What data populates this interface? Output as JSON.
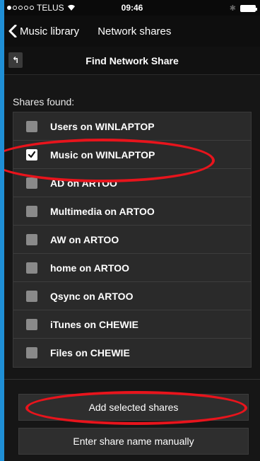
{
  "status_bar": {
    "carrier": "TELUS",
    "time": "09:46",
    "signal_dots_filled": 1,
    "signal_dots_total": 5
  },
  "nav": {
    "back_label": "Music library",
    "tab_label": "Network shares"
  },
  "header": {
    "title": "Find Network Share"
  },
  "shares_label": "Shares found:",
  "shares": [
    {
      "label": "Users on WINLAPTOP",
      "checked": false
    },
    {
      "label": "Music on WINLAPTOP",
      "checked": true
    },
    {
      "label": "AD on ARTOO",
      "checked": false
    },
    {
      "label": "Multimedia on ARTOO",
      "checked": false
    },
    {
      "label": "AW on ARTOO",
      "checked": false
    },
    {
      "label": "home on ARTOO",
      "checked": false
    },
    {
      "label": "Qsync on ARTOO",
      "checked": false
    },
    {
      "label": "iTunes on CHEWIE",
      "checked": false
    },
    {
      "label": "Files on CHEWIE",
      "checked": false
    }
  ],
  "buttons": {
    "add_selected": "Add selected shares",
    "enter_manually": "Enter share name manually"
  },
  "colors": {
    "page_background": "#1f8fd6",
    "annotation": "#e8141c"
  }
}
